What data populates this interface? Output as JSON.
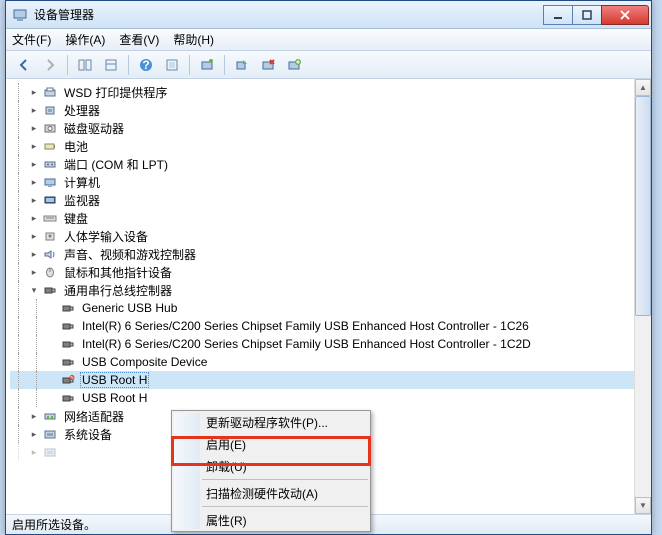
{
  "window": {
    "title": "设备管理器"
  },
  "menu": {
    "file": "文件(F)",
    "action": "操作(A)",
    "view": "查看(V)",
    "help": "帮助(H)"
  },
  "tree": {
    "items": [
      {
        "label": "WSD 打印提供程序",
        "icon": "printer"
      },
      {
        "label": "处理器",
        "icon": "cpu"
      },
      {
        "label": "磁盘驱动器",
        "icon": "disk"
      },
      {
        "label": "电池",
        "icon": "battery"
      },
      {
        "label": "端口 (COM 和 LPT)",
        "icon": "port"
      },
      {
        "label": "计算机",
        "icon": "computer"
      },
      {
        "label": "监视器",
        "icon": "monitor"
      },
      {
        "label": "键盘",
        "icon": "keyboard"
      },
      {
        "label": "人体学输入设备",
        "icon": "hid"
      },
      {
        "label": "声音、视频和游戏控制器",
        "icon": "sound"
      },
      {
        "label": "鼠标和其他指针设备",
        "icon": "mouse"
      },
      {
        "label": "通用串行总线控制器",
        "icon": "usb",
        "expanded": true,
        "children": [
          {
            "label": "Generic USB Hub",
            "icon": "usb"
          },
          {
            "label": "Intel(R) 6 Series/C200 Series Chipset Family USB Enhanced Host Controller - 1C26",
            "icon": "usb"
          },
          {
            "label": "Intel(R) 6 Series/C200 Series Chipset Family USB Enhanced Host Controller - 1C2D",
            "icon": "usb"
          },
          {
            "label": "USB Composite Device",
            "icon": "usb"
          },
          {
            "label": "USB Root H",
            "icon": "usb-disabled",
            "selected": true
          },
          {
            "label": "USB Root H",
            "icon": "usb"
          }
        ]
      },
      {
        "label": "网络适配器",
        "icon": "network"
      },
      {
        "label": "系统设备",
        "icon": "system"
      }
    ]
  },
  "context_menu": {
    "update_driver": "更新驱动程序软件(P)...",
    "enable": "启用(E)",
    "uninstall": "卸载(U)",
    "scan": "扫描检测硬件改动(A)",
    "properties": "属性(R)"
  },
  "statusbar": {
    "text": "启用所选设备。"
  }
}
